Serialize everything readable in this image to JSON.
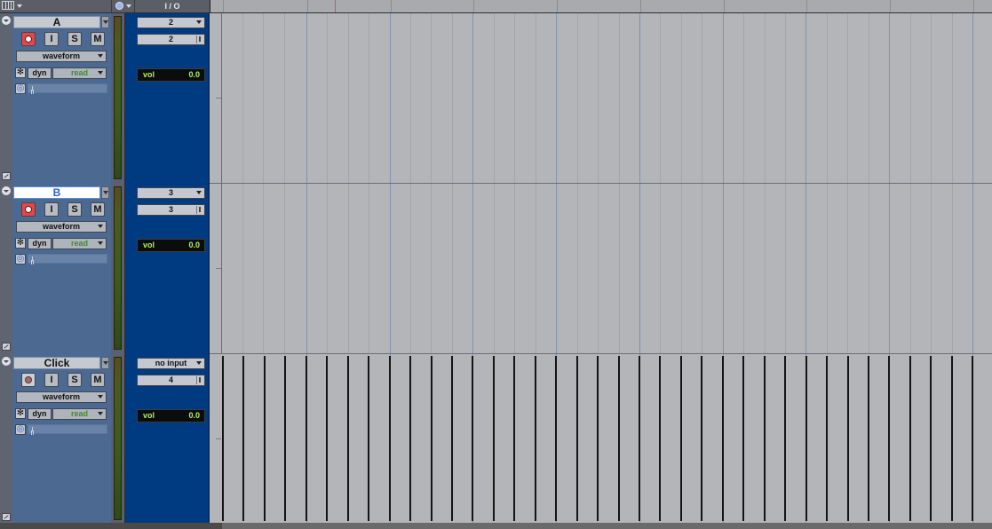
{
  "header": {
    "io_label": "I / O"
  },
  "tracks": [
    {
      "name": "A",
      "rec_state": "active",
      "buttons": {
        "input": "I",
        "solo": "S",
        "mute": "M"
      },
      "view": "waveform",
      "dyn": "dyn",
      "automation": "read",
      "input": "2",
      "output": "2",
      "vol_label": "vol",
      "vol_value": "0.0"
    },
    {
      "name": "B",
      "rec_state": "active",
      "buttons": {
        "input": "I",
        "solo": "S",
        "mute": "M"
      },
      "view": "waveform",
      "dyn": "dyn",
      "automation": "read",
      "input": "3",
      "output": "3",
      "vol_label": "vol",
      "vol_value": "0.0"
    },
    {
      "name": "Click",
      "rec_state": "inactive",
      "buttons": {
        "input": "I",
        "solo": "S",
        "mute": "M"
      },
      "view": "waveform",
      "dyn": "dyn",
      "automation": "read",
      "input": "no input",
      "output": "4",
      "vol_label": "vol",
      "vol_value": "0.0"
    }
  ],
  "colors": {
    "track_header": "#4b6991",
    "io_column": "#003a80",
    "clip_bg": "#b4b5b8",
    "vol_text": "#b8ec6a",
    "rec_active": "#e54747"
  }
}
